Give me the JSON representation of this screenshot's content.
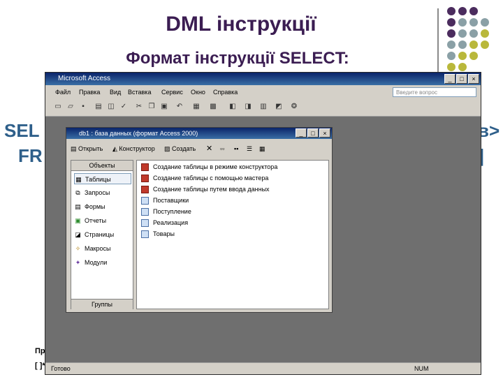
{
  "slide": {
    "title": "DML інструкції",
    "subtitle": "Формат інструкції SELECT:",
    "bg_fragments": {
      "sel": "SEL",
      "fr": "FR",
      "suffix1": "в>",
      "suffix2": "|",
      "pr": "Пр",
      "bracket": "[ ]*"
    },
    "colors": {
      "title": "#3b1d52",
      "dot_purple": "#4b2c5e",
      "dot_gray": "#8aa0a6",
      "dot_olive": "#b9b83b"
    }
  },
  "access": {
    "title": "Microsoft Access",
    "menu": [
      "Файл",
      "Правка",
      "Вид",
      "Вставка",
      "Сервис",
      "Окно",
      "Справка"
    ],
    "help_placeholder": "Введите вопрос",
    "status_left": "Готово",
    "status_right": "NUM"
  },
  "db": {
    "title": "db1 : база данных (формат Access 2000)",
    "toolbar": {
      "open": "Открыть",
      "design": "Конструктор",
      "create": "Создать"
    },
    "objects_header": "Объекты",
    "groups_header": "Группы",
    "objects": [
      {
        "label": "Таблицы",
        "icon": "table-icon"
      },
      {
        "label": "Запросы",
        "icon": "query-icon"
      },
      {
        "label": "Формы",
        "icon": "form-icon"
      },
      {
        "label": "Отчеты",
        "icon": "report-icon"
      },
      {
        "label": "Страницы",
        "icon": "page-icon"
      },
      {
        "label": "Макросы",
        "icon": "macro-icon"
      },
      {
        "label": "Модули",
        "icon": "module-icon"
      }
    ],
    "items": [
      "Создание таблицы в режиме конструктора",
      "Создание таблицы с помощью мастера",
      "Создание таблицы путем ввода данных",
      "Поставщики",
      "Поступление",
      "Реализация",
      "Товары"
    ]
  }
}
